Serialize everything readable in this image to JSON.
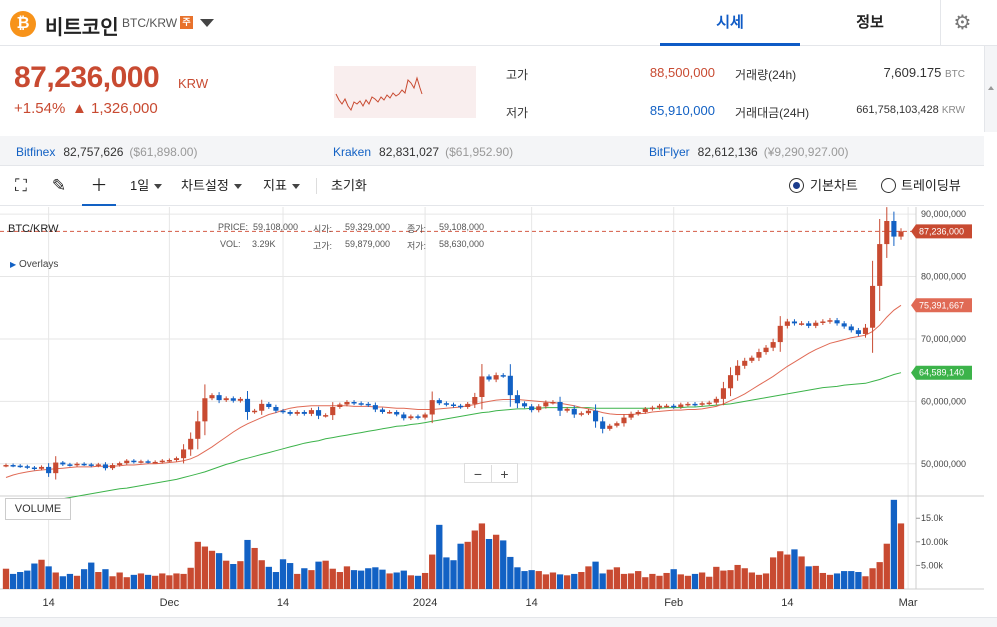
{
  "header": {
    "coin_symbol": "₿",
    "coin_name": "비트코인",
    "pair": "BTC/KRW",
    "warning_badge": "주",
    "tabs": [
      {
        "label": "시세"
      },
      {
        "label": "정보"
      }
    ],
    "settings_icon": "gear-icon"
  },
  "summary": {
    "price": "87,236,000",
    "unit": "KRW",
    "change_pct": "+1.54%",
    "change_amt": "▲ 1,326,000",
    "high_label": "고가",
    "high": "88,500,000",
    "low_label": "저가",
    "low": "85,910,000",
    "volume_label": "거래량(24h)",
    "volume": "7,609.175",
    "volume_unit": "BTC",
    "turnover_label": "거래대금(24H)",
    "turnover": "661,758,103,428",
    "turnover_unit": "KRW"
  },
  "exchanges": [
    {
      "name": "Bitfinex",
      "value": "82,757,626",
      "usd": "($61,898.00)"
    },
    {
      "name": "Kraken",
      "value": "82,831,027",
      "usd": "($61,952.90)"
    },
    {
      "name": "BitFlyer",
      "value": "82,612,136",
      "usd": "(¥9,290,927.00)"
    }
  ],
  "toolbar": {
    "period": "1일",
    "chart_settings": "차트설정",
    "indicators": "지표",
    "reset": "초기화",
    "mode_basic": "기본차트",
    "mode_tv": "트레이딩뷰"
  },
  "chart_overlay": {
    "pair": "BTC/KRW",
    "overlays": "Overlays",
    "price_label": "PRICE:",
    "price": "59,108,000",
    "open_label": "시가:",
    "open": "59,329,000",
    "close_label": "종가:",
    "close": "59,108,000",
    "vol_label": "VOL:",
    "vol": "3.29K",
    "high_label": "고가:",
    "high": "59,879,000",
    "low_label": "저가:",
    "low": "58,630,000",
    "volume_title": "VOLUME"
  },
  "chart_data": {
    "type": "candlestick",
    "y_ticks": [
      "90,000,000",
      "80,000,000",
      "70,000,000",
      "60,000,000",
      "50,000,000"
    ],
    "y_tick_values": [
      90000000,
      80000000,
      70000000,
      60000000,
      50000000
    ],
    "ylim": [
      45000000,
      90500000
    ],
    "x_ticks": [
      "14",
      "Dec",
      "14",
      "2024",
      "14",
      "Feb",
      "14",
      "Mar"
    ],
    "x_tick_index": [
      6,
      23,
      39,
      59,
      74,
      94,
      110,
      127
    ],
    "last_price_label": "87,236,000",
    "ma_short_label": "75,391,667",
    "ma_long_label": "64,589,140",
    "volume_ticks": [
      "15.0k",
      "10.00k",
      "5.00k"
    ],
    "volume_tick_values": [
      15000,
      10000,
      5000
    ],
    "volume_max": 19500,
    "colors": {
      "up": "#c84a31",
      "down": "#1261c4",
      "ma_short": "#e06a55",
      "ma_long": "#3cb34a"
    },
    "closes": [
      49800000,
      49700000,
      49600000,
      49400000,
      49200000,
      49500000,
      48500000,
      50200000,
      49900000,
      49800000,
      50000000,
      49900000,
      49700000,
      49900000,
      49300000,
      49800000,
      50100000,
      50500000,
      50300000,
      50400000,
      50300000,
      50300000,
      50500000,
      50600000,
      50900000,
      52300000,
      54000000,
      56800000,
      60500000,
      61000000,
      60200000,
      60500000,
      60100000,
      60400000,
      58300000,
      58500000,
      59600000,
      59100000,
      58500000,
      58300000,
      58000000,
      58300000,
      58000000,
      58600000,
      57700000,
      57800000,
      59100000,
      59500000,
      59900000,
      59700000,
      59600000,
      59400000,
      58700000,
      58300000,
      58300000,
      57900000,
      57300000,
      57600000,
      57400000,
      57900000,
      60200000,
      59700000,
      59500000,
      59300000,
      59100000,
      59600000,
      60700000,
      64000000,
      63500000,
      64200000,
      64100000,
      61000000,
      59700000,
      59200000,
      58600000,
      59200000,
      59800000,
      59900000,
      58500000,
      58800000,
      57900000,
      58100000,
      58500000,
      56800000,
      55600000,
      56100000,
      56500000,
      57400000,
      58000000,
      58300000,
      58800000,
      59000000,
      59300000,
      59300000,
      59100000,
      59500000,
      59600000,
      59500000,
      59700000,
      59800000,
      60400000,
      62100000,
      64200000,
      65700000,
      66500000,
      67000000,
      67900000,
      68600000,
      69500000,
      72100000,
      72800000,
      72500000,
      72500000,
      72100000,
      72600000,
      72800000,
      73000000,
      72500000,
      72000000,
      71400000,
      70800000,
      71800000,
      78500000,
      85200000,
      88900000,
      86400000,
      87236000
    ],
    "volumes": [
      4300,
      3200,
      3600,
      3900,
      5400,
      6200,
      4800,
      3500,
      2700,
      3200,
      2800,
      4200,
      5600,
      3600,
      4200,
      2700,
      3500,
      2500,
      3000,
      3300,
      3000,
      2800,
      3300,
      2900,
      3300,
      3200,
      4500,
      10000,
      9000,
      8100,
      7600,
      6000,
      5300,
      5900,
      10400,
      8700,
      6100,
      4700,
      3600,
      6300,
      5500,
      3200,
      4400,
      4000,
      5800,
      6000,
      4300,
      3600,
      4800,
      4000,
      3900,
      4400,
      4600,
      4100,
      3300,
      3500,
      3900,
      2900,
      2800,
      3400,
      7300,
      13600,
      6700,
      6100,
      9600,
      10000,
      12400,
      13900,
      10600,
      11500,
      10300,
      6800,
      4600,
      3800,
      4000,
      3800,
      3100,
      3500,
      3100,
      2900,
      3200,
      3600,
      4800,
      5800,
      3300,
      4100,
      4600,
      3200,
      3300,
      3800,
      2500,
      3200,
      2800,
      3400,
      4200,
      3100,
      2800,
      3200,
      3500,
      2600,
      4700,
      3900,
      4000,
      5100,
      4400,
      3500,
      3000,
      3300,
      6700,
      8000,
      7300,
      8400,
      6900,
      4800,
      4900,
      3400,
      3000,
      3300,
      3800,
      3800,
      3600,
      2700,
      4400,
      5700,
      9600,
      18900,
      13900,
      4500
    ],
    "ma_short": [
      47800000,
      48200000,
      48500000,
      48700000,
      48900000,
      49000000,
      49100000,
      49200000,
      49300000,
      49400000,
      49500000,
      49500000,
      49500000,
      49600000,
      49600000,
      49600000,
      49700000,
      49800000,
      49800000,
      49900000,
      50000000,
      50000000,
      50100000,
      50200000,
      50300000,
      50500000,
      50800000,
      51300000,
      52000000,
      52700000,
      53500000,
      54300000,
      55100000,
      55800000,
      56400000,
      56900000,
      57400000,
      57900000,
      58200000,
      58600000,
      58900000,
      59100000,
      59200000,
      59300000,
      59300000,
      59300000,
      59300000,
      59300000,
      59300000,
      59200000,
      59200000,
      59200000,
      59100000,
      59100000,
      59000000,
      58900000,
      58900000,
      58800000,
      58700000,
      58700000,
      58700000,
      58800000,
      58900000,
      59000000,
      59100000,
      59300000,
      59500000,
      59800000,
      60000000,
      60200000,
      60300000,
      60300000,
      60300000,
      60200000,
      60100000,
      60000000,
      59900000,
      59800000,
      59700000,
      59500000,
      59300000,
      59000000,
      58800000,
      58500000,
      58200000,
      58000000,
      57900000,
      57900000,
      57900000,
      58000000,
      58100000,
      58300000,
      58400000,
      58500000,
      58600000,
      58600000,
      58700000,
      58700000,
      58800000,
      59000000,
      59200000,
      59600000,
      60100000,
      60600000,
      61200000,
      61900000,
      62600000,
      63300000,
      64000000,
      64800000,
      65600000,
      66300000,
      67000000,
      67700000,
      68300000,
      68800000,
      69300000,
      69600000,
      69900000,
      70200000,
      70400000,
      70600000,
      71200000,
      72200000,
      73500000,
      74600000,
      75391667
    ],
    "ma_long": [
      42500000,
      42800000,
      43100000,
      43300000,
      43500000,
      43800000,
      44000000,
      44200000,
      44400000,
      44600000,
      44800000,
      45000000,
      45200000,
      45400000,
      45600000,
      45800000,
      46000000,
      46100000,
      46300000,
      46500000,
      46700000,
      46900000,
      47100000,
      47300000,
      47500000,
      47800000,
      48100000,
      48400000,
      48700000,
      49100000,
      49500000,
      49900000,
      50200000,
      50600000,
      50900000,
      51200000,
      51500000,
      51800000,
      52100000,
      52400000,
      52700000,
      53000000,
      53300000,
      53500000,
      53700000,
      54000000,
      54200000,
      54400000,
      54600000,
      54800000,
      55000000,
      55200000,
      55400000,
      55600000,
      55800000,
      56000000,
      56100000,
      56300000,
      56400000,
      56600000,
      56800000,
      57000000,
      57200000,
      57400000,
      57600000,
      57800000,
      58000000,
      58200000,
      58300000,
      58500000,
      58600000,
      58700000,
      58800000,
      58800000,
      58900000,
      58900000,
      59000000,
      59000000,
      59000000,
      59000000,
      59000000,
      59000000,
      59000000,
      58900000,
      58900000,
      58900000,
      58900000,
      58900000,
      58900000,
      58900000,
      58900000,
      58900000,
      58900000,
      59000000,
      59000000,
      59000000,
      59100000,
      59100000,
      59200000,
      59300000,
      59400000,
      59500000,
      59600000,
      59800000,
      60000000,
      60200000,
      60400000,
      60600000,
      60800000,
      61000000,
      61200000,
      61400000,
      61600000,
      61800000,
      62000000,
      62200000,
      62300000,
      62400000,
      62600000,
      62700000,
      62800000,
      62900000,
      63200000,
      63500000,
      63900000,
      64300000,
      64589140
    ]
  }
}
